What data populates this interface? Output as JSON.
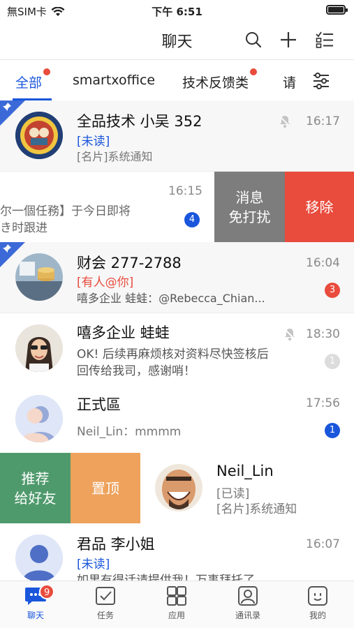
{
  "status_bar": {
    "carrier": "無SIM卡",
    "time": "下午 6:51"
  },
  "nav": {
    "title": "聊天"
  },
  "filter_tabs": [
    {
      "label": "全部",
      "active": true,
      "dot": true
    },
    {
      "label": "smartxoffice",
      "active": false,
      "dot": false
    },
    {
      "label": "技术反馈类",
      "active": false,
      "dot": true
    },
    {
      "label": "请",
      "active": false,
      "dot": false
    }
  ],
  "chats": [
    {
      "name": "全品技术 小吴 352",
      "tag": "[未读]",
      "preview": "[名片]系统通知",
      "time": "16:17",
      "pinned": true,
      "muted": true
    },
    {
      "preview_line1": "尔一個任務】于今日即将",
      "preview_line2": "き时跟进",
      "time": "16:15",
      "badge": "4",
      "actions": [
        "消息\n免打扰",
        "移除"
      ]
    },
    {
      "name": "财会 277-2788",
      "tag": "[有人@你]",
      "preview": "嘻多企业 蛙蛙：@Rebecca_Chian...",
      "time": "16:04",
      "badge": "3",
      "pinned": true
    },
    {
      "name": "嘻多企业 蛙蛙",
      "preview": "OK! 后续再麻烦核对资料尽快签核后回传给我司，感谢哨！",
      "preview_line1": "OK! 后续再麻烦核对资料尽快签核后",
      "preview_line2": "回传给我司，感谢哨！",
      "time": "18:30",
      "badge": "1",
      "muted": true
    },
    {
      "name": "正式區",
      "preview": "Neil_Lin：mmmm",
      "time": "17:56",
      "badge": "1"
    },
    {
      "name": "Neil_Lin",
      "tag": "[已读]",
      "preview": "[名片]系统通知",
      "actions": [
        "推荐\n给好友",
        "置顶"
      ]
    },
    {
      "name": "君品 李小姐",
      "tag": "[未读]",
      "preview": "如果有得话请提供我！万事拜托了...",
      "time": "16:07"
    }
  ],
  "swipe_actions": {
    "mute": [
      "消息",
      "免打扰"
    ],
    "remove": "移除",
    "recommend": [
      "推荐",
      "给好友"
    ],
    "pin": "置顶"
  },
  "tab_bar": [
    {
      "label": "聊天",
      "active": true,
      "badge": "9"
    },
    {
      "label": "任务",
      "active": false
    },
    {
      "label": "应用",
      "active": false
    },
    {
      "label": "通讯录",
      "active": false
    },
    {
      "label": "我的",
      "active": false
    }
  ],
  "colors": {
    "accent": "#1a56db",
    "red": "#e94b3c",
    "mute_gray": "#7d7d7d",
    "recommend_green": "#4f9a6d",
    "pin_orange": "#eea25c"
  }
}
